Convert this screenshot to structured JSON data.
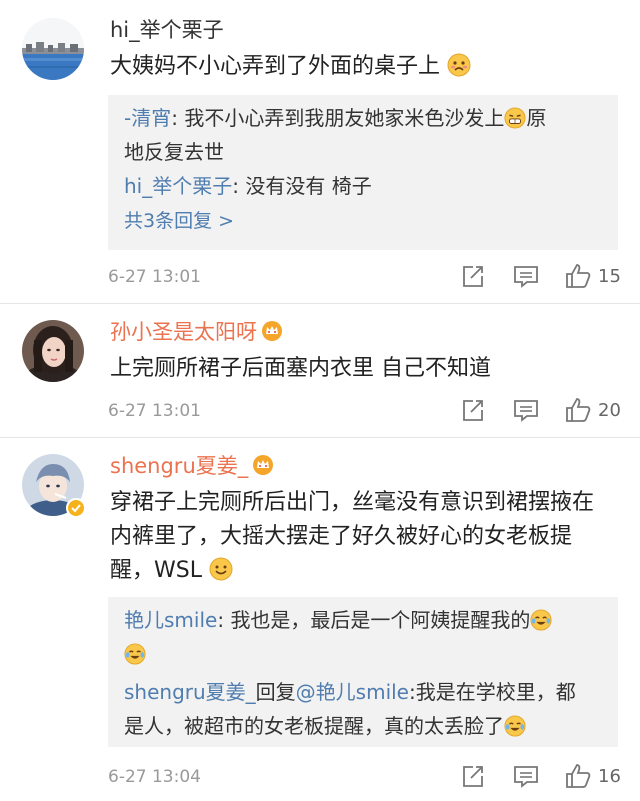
{
  "comments": [
    {
      "username": "hi_举个栗子",
      "text": "大姨妈不小心弄到了外面的桌子上",
      "replies": [
        {
          "name": "-清宵",
          "text": "我不小心弄到我朋友她家米色沙发上",
          "text2": "原",
          "text3": "地反复去世"
        },
        {
          "name": "hi_举个栗子",
          "text": "没有没有 椅子"
        }
      ],
      "more_replies": "共3条回复 >",
      "time": "6-27 13:01",
      "likes": "15"
    },
    {
      "username": "孙小圣是太阳呀",
      "text": "上完厕所裙子后面塞内衣里 自己不知道",
      "time": "6-27 13:01",
      "likes": "20"
    },
    {
      "username": "shengru夏姜_",
      "text_lines": [
        "穿裙子上完厕所后出门，丝毫没有意识到裙摆掖在",
        "内裤里了，大摇大摆走了好久被好心的女老板提",
        "醒，WSL"
      ],
      "replies": [
        {
          "name": "艳儿smile",
          "text": "我也是，最后是一个阿姨提醒我的"
        },
        {
          "name": "shengru夏姜_",
          "reply_word": "回复",
          "mention": "@艳儿smile",
          "text": ":我是在学校里，都",
          "text2": "是人，被超市的女老板提醒，真的太丢脸了"
        }
      ],
      "time": "6-27 13:04",
      "likes": "16"
    }
  ],
  "colors": {
    "link_blue": "#507daf",
    "vip_orange": "#eb7350",
    "reply_bg": "#f2f2f2",
    "time_gray": "#999999"
  },
  "icons": [
    "share-icon",
    "comment-icon",
    "like-icon",
    "vip-crown-icon",
    "cry-laugh-emoji",
    "grimace-emoji",
    "smile-emoji",
    "pouting-emoji"
  ]
}
